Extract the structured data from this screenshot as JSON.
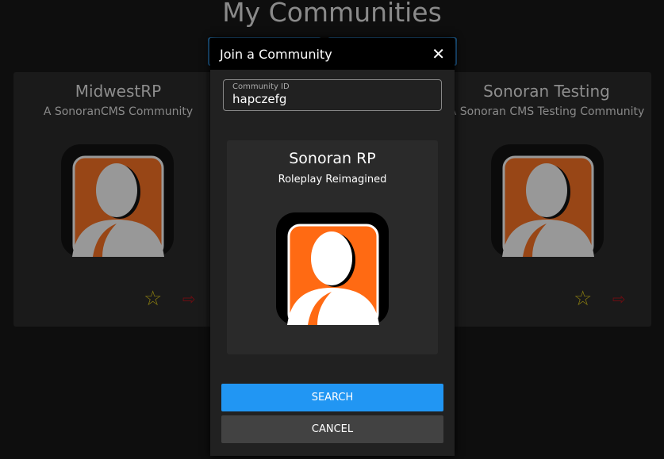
{
  "page_title": "My Communities",
  "communities": [
    {
      "name": "MidwestRP",
      "description": "A SonoranCMS Community"
    },
    {
      "name": "Sonoran Testing",
      "description": "A Sonoran CMS Testing Community"
    }
  ],
  "modal": {
    "title": "Join a Community",
    "field_label": "Community ID",
    "field_value": "hapczefg",
    "result": {
      "name": "Sonoran RP",
      "description": "Roleplay Reimagined"
    },
    "search_label": "SEARCH",
    "cancel_label": "CANCEL"
  },
  "colors": {
    "accent": "#2196f3",
    "logo_orange": "#ff6a13",
    "star": "#c8b41a",
    "leave": "#a0141c"
  }
}
